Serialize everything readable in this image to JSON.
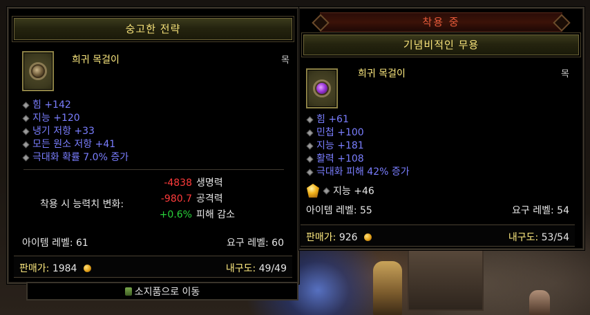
{
  "left_tooltip": {
    "header_title": "숭고한 전략",
    "item_name": "희귀 목걸이",
    "item_slot": "목",
    "stats": [
      "힘 +142",
      "지능 +120",
      "냉기 저항 +33",
      "모든 원소 저항 +41",
      "극대화 확률 7.0% 증가"
    ],
    "change_label": "착용 시 능력치 변화:",
    "changes": [
      {
        "value": "-4838",
        "label": "생명력",
        "sign": "neg"
      },
      {
        "value": "-980.7",
        "label": "공격력",
        "sign": "neg"
      },
      {
        "value": "+0.6%",
        "label": "피해 감소",
        "sign": "pos"
      }
    ],
    "item_level": "아이템 레벨: 61",
    "required_level": "요구 레벨: 60",
    "sell_price_label": "판매가:",
    "sell_price_value": "1984",
    "durability_label": "내구도:",
    "durability_value": "49/49",
    "icon": "gold-coin-icon"
  },
  "right_tooltip": {
    "equipped_label": "착용 중",
    "header_title": "기념비적인 무용",
    "item_name": "희귀 목걸이",
    "item_slot": "목",
    "stats": [
      "힘 +61",
      "민첩 +100",
      "지능 +181",
      "활력 +108",
      "극대화 피해 42% 증가"
    ],
    "socket_stat": "지능 +46",
    "item_level": "아이템 레벨: 55",
    "required_level": "요구 레벨: 54",
    "sell_price_label": "판매가:",
    "sell_price_value": "926",
    "durability_label": "내구도:",
    "durability_value": "53/54"
  },
  "move_to_inventory": "소지품으로 이동",
  "colors": {
    "header_text": "#f6e27a",
    "stat_blue": "#7a7eff",
    "negative_red": "#ff3b3b",
    "positive_green": "#28d23a",
    "equipped_red": "#e55a3a"
  }
}
